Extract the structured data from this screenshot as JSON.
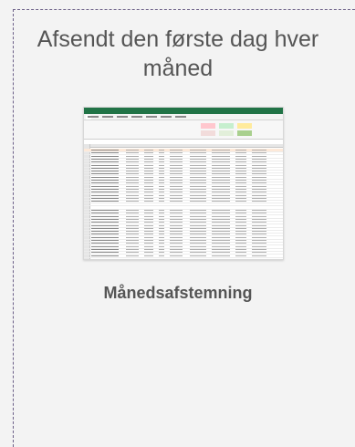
{
  "card": {
    "heading": "Afsendt den første dag hver måned",
    "label": "Månedsafstemning"
  },
  "thumbnail": {
    "icon": "spreadsheet-icon",
    "colors": {
      "title_bar": "#217346",
      "style_bad": "#ffc7ce",
      "style_good": "#c6efce",
      "style_neutral": "#ffeb9c",
      "header_row": "#fde9d9",
      "gridlines": "#c8c8c8"
    }
  }
}
